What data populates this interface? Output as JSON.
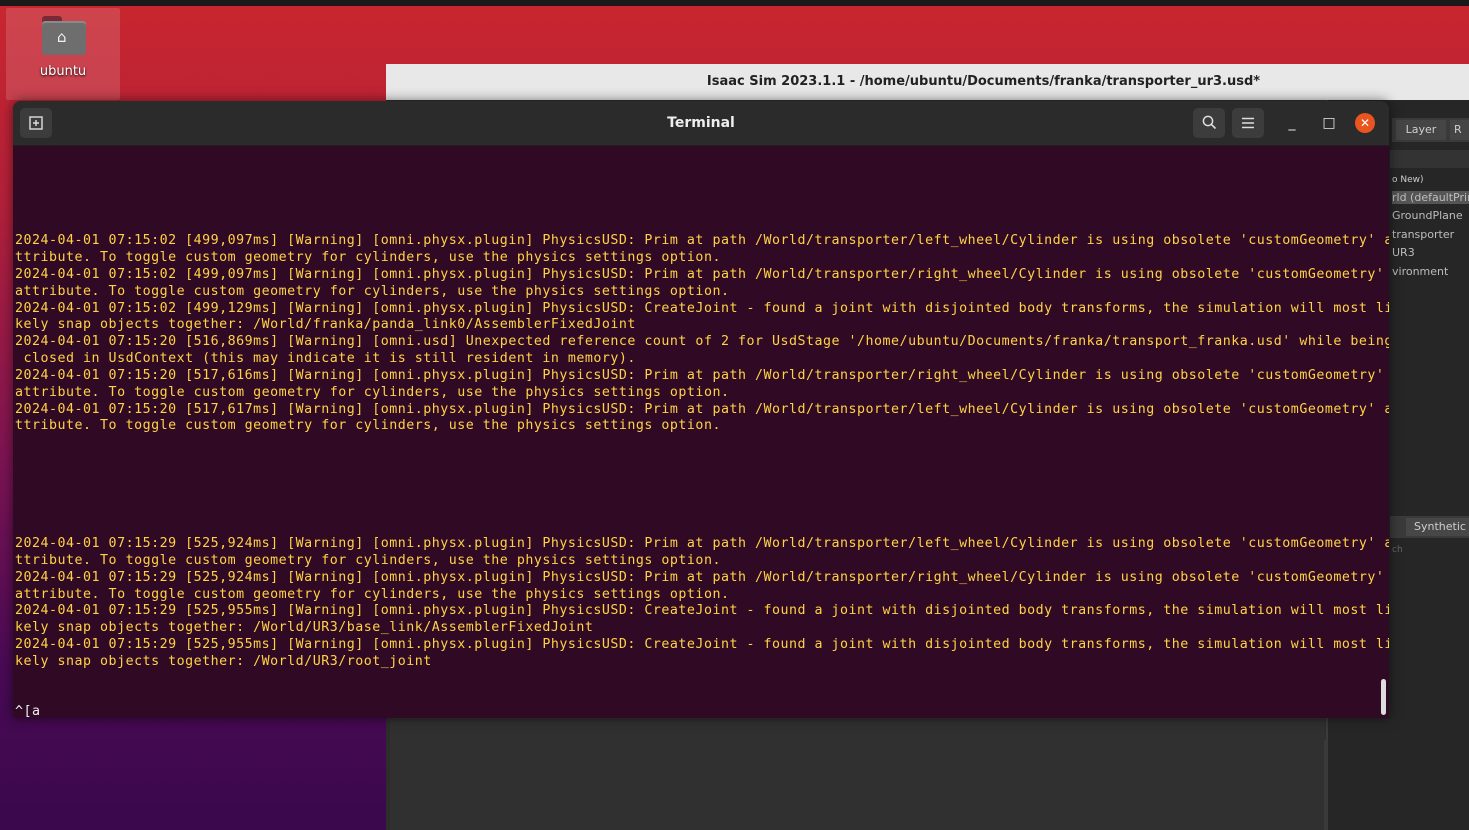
{
  "desktop": {
    "home_icon": "home-icon",
    "label": "ubuntu"
  },
  "isaac_window": {
    "title": "Isaac Sim 2023.1.1 - /home/ubuntu/Documents/franka/transporter_ur3.usd*",
    "tabs": [
      "Layer",
      "R"
    ],
    "stage_header": "o New)",
    "stage_items": [
      "rld (defaultPrim",
      "GroundPlane",
      "transporter",
      "UR3",
      "vironment"
    ],
    "bottom_tab": "Synthetic D",
    "bottom_sub": "ch"
  },
  "terminal": {
    "title": "Terminal",
    "buttons": {
      "new_tab_icon": "new-tab-icon",
      "search_icon": "search-icon",
      "menu_icon": "hamburger-menu-icon",
      "minimize": "_",
      "maximize": "□",
      "close": "✕"
    },
    "lines": [
      "2024-04-01 07:15:02 [499,097ms] [Warning] [omni.physx.plugin] PhysicsUSD: Prim at path /World/transporter/left_wheel/Cylinder is using obsolete 'customGeometry' a",
      "ttribute. To toggle custom geometry for cylinders, use the physics settings option.",
      "2024-04-01 07:15:02 [499,097ms] [Warning] [omni.physx.plugin] PhysicsUSD: Prim at path /World/transporter/right_wheel/Cylinder is using obsolete 'customGeometry'",
      "attribute. To toggle custom geometry for cylinders, use the physics settings option.",
      "2024-04-01 07:15:02 [499,129ms] [Warning] [omni.physx.plugin] PhysicsUSD: CreateJoint - found a joint with disjointed body transforms, the simulation will most li",
      "kely snap objects together: /World/franka/panda_link0/AssemblerFixedJoint",
      "2024-04-01 07:15:20 [516,869ms] [Warning] [omni.usd] Unexpected reference count of 2 for UsdStage '/home/ubuntu/Documents/franka/transport_franka.usd' while being",
      " closed in UsdContext (this may indicate it is still resident in memory).",
      "2024-04-01 07:15:20 [517,616ms] [Warning] [omni.physx.plugin] PhysicsUSD: Prim at path /World/transporter/right_wheel/Cylinder is using obsolete 'customGeometry'",
      "attribute. To toggle custom geometry for cylinders, use the physics settings option.",
      "2024-04-01 07:15:20 [517,617ms] [Warning] [omni.physx.plugin] PhysicsUSD: Prim at path /World/transporter/left_wheel/Cylinder is using obsolete 'customGeometry' a",
      "ttribute. To toggle custom geometry for cylinders, use the physics settings option.",
      "2024-04-01 07:15:29 [525,924ms] [Warning] [omni.physx.plugin] PhysicsUSD: Prim at path /World/transporter/left_wheel/Cylinder is using obsolete 'customGeometry' a",
      "ttribute. To toggle custom geometry for cylinders, use the physics settings option.",
      "2024-04-01 07:15:29 [525,924ms] [Warning] [omni.physx.plugin] PhysicsUSD: Prim at path /World/transporter/right_wheel/Cylinder is using obsolete 'customGeometry'",
      "attribute. To toggle custom geometry for cylinders, use the physics settings option.",
      "2024-04-01 07:15:29 [525,955ms] [Warning] [omni.physx.plugin] PhysicsUSD: CreateJoint - found a joint with disjointed body transforms, the simulation will most li",
      "kely snap objects together: /World/UR3/base_link/AssemblerFixedJoint",
      "2024-04-01 07:15:29 [525,955ms] [Warning] [omni.physx.plugin] PhysicsUSD: CreateJoint - found a joint with disjointed body transforms, the simulation will most li",
      "kely snap objects together: /World/UR3/root_joint"
    ],
    "prompt_input": "^[a"
  },
  "colors": {
    "terminal_bg": "#300a24",
    "warning_text": "#ffd246",
    "close_button": "#e95420"
  }
}
